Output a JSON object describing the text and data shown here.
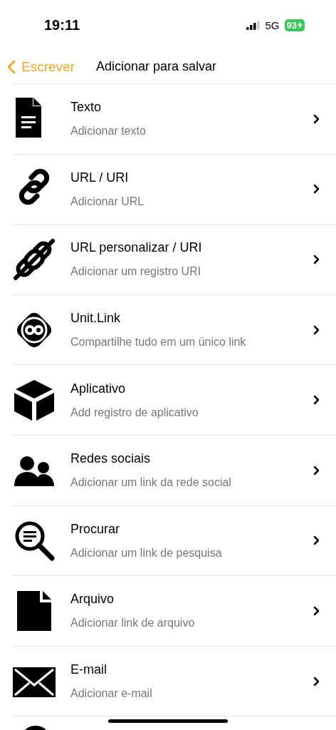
{
  "status_bar": {
    "time": "19:11",
    "network": "5G",
    "battery": "93"
  },
  "nav": {
    "back": "Escrever",
    "title": "Adicionar para salvar"
  },
  "items": [
    {
      "title": "Texto",
      "subtitle": "Adicionar texto"
    },
    {
      "title": "URL / URI",
      "subtitle": "Adicionar URL"
    },
    {
      "title": "URL personalizar / URI",
      "subtitle": "Adicionar um registro URI"
    },
    {
      "title": "Unit.Link",
      "subtitle": "Compartilhe tudo em um único link"
    },
    {
      "title": "Aplicativo",
      "subtitle": "Add registro de aplicativo"
    },
    {
      "title": "Redes sociais",
      "subtitle": "Adicionar um link da rede social"
    },
    {
      "title": "Procurar",
      "subtitle": "Adicionar um link de pesquisa"
    },
    {
      "title": "Arquivo",
      "subtitle": "Adicionar link de arquivo"
    },
    {
      "title": "E-mail",
      "subtitle": "Adicionar e-mail"
    }
  ]
}
